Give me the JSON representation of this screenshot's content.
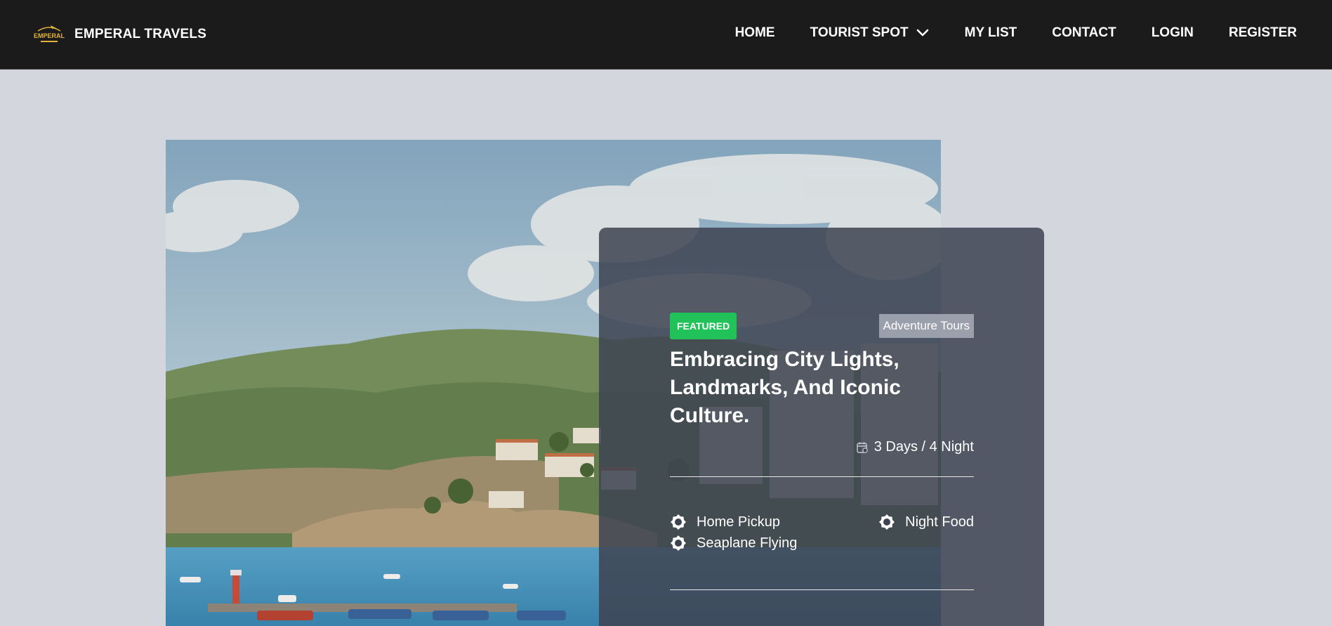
{
  "header": {
    "brand": "EMPERAL TRAVELS",
    "logo_text": "EMPERAL",
    "nav": [
      {
        "label": "HOME"
      },
      {
        "label": "TOURIST SPOT",
        "has_dropdown": true
      },
      {
        "label": "MY LIST"
      },
      {
        "label": "CONTACT"
      },
      {
        "label": "LOGIN"
      },
      {
        "label": "REGISTER"
      }
    ]
  },
  "featured": {
    "badge": "FEATURED",
    "category": "Adventure Tours",
    "title": "Embracing City Lights, Landmarks, And Iconic Culture.",
    "duration": "3 Days / 4 Night",
    "features": [
      "Home Pickup",
      "Night Food",
      "Seaplane Flying"
    ]
  },
  "colors": {
    "nav_bg": "#1b1b1b",
    "page_bg": "#d4d6de",
    "badge_green": "#22c25a",
    "card_overlay": "#3e4352"
  },
  "icons": {
    "logo": "airplane-logo-icon",
    "dropdown": "chevron-down-icon",
    "duration": "calendar-icon",
    "feature": "gear-icon"
  }
}
